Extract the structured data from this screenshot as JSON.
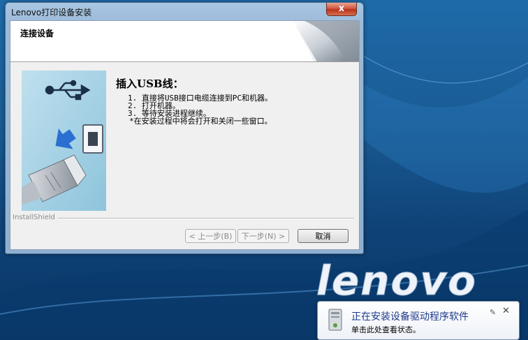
{
  "window": {
    "title": "Lenovo打印设备安装",
    "close_symbol": "x"
  },
  "header": {
    "title": "连接设备"
  },
  "content": {
    "heading": "插入USB线：",
    "steps": [
      "1. 直接将USB接口电缆连接到PC和机器。",
      "2. 打开机器。",
      "3. 等待安装进程继续。",
      " *在安装过程中将会打开和关闭一些窗口。"
    ]
  },
  "footer": {
    "installshield_label": "InstallShield",
    "back_label": "< 上一步(B)",
    "next_label": "下一步(N) >",
    "cancel_label": "取消"
  },
  "desktop": {
    "brand_text": "lenovo"
  },
  "notification": {
    "title": "正在安装设备驱动程序软件",
    "subtitle": "单击此处查看状态。",
    "pin_symbol": "✎",
    "close_symbol": "✕"
  },
  "colors": {
    "accent_blue": "#2a6fd1",
    "desktop_blue": "#1a5c94",
    "close_red": "#c8432a"
  }
}
